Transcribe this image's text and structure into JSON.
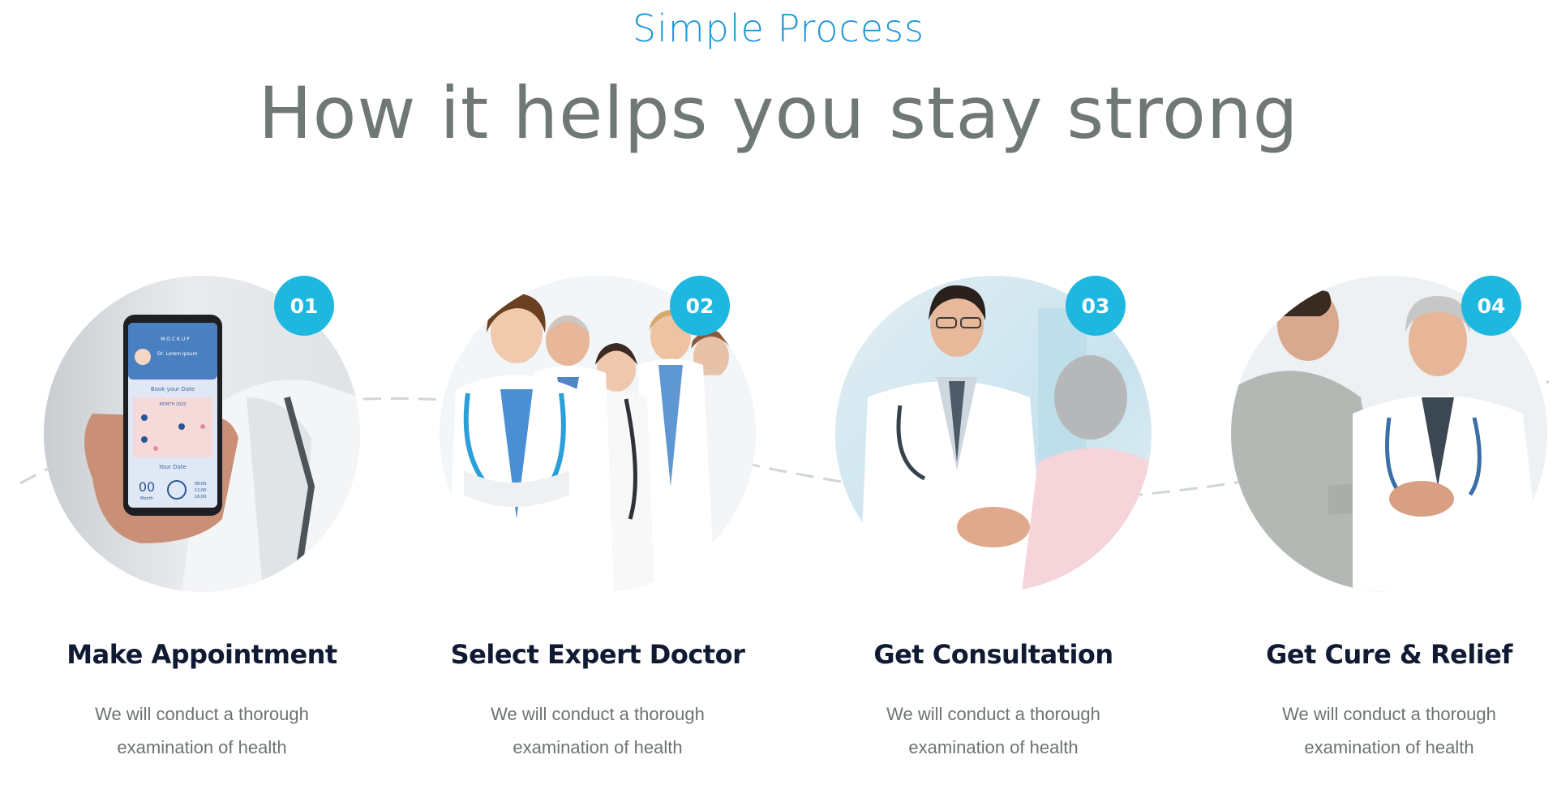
{
  "section": {
    "eyebrow": "Simple Process",
    "headline": "How it helps you stay strong"
  },
  "colors": {
    "eyebrow": "#1f97d9",
    "headline": "#6f7777",
    "badge": "#1eb7df",
    "title": "#101a33",
    "text": "#6d7273"
  },
  "steps": [
    {
      "number": "01",
      "title": "Make Appointment",
      "desc_line1": "We will conduct a thorough",
      "desc_line2": "examination of health",
      "image": "doctor-holding-phone-app",
      "phone": {
        "brand": "M O C K U P",
        "doctor": "Dr. Lorem Ipsum",
        "book_label": "Book your Date",
        "month_label": "MONTH 2020",
        "date_label": "Your Date",
        "count": "00",
        "count_unit": "Month",
        "times": [
          "08:00",
          "12:00",
          "16:00"
        ]
      }
    },
    {
      "number": "02",
      "title": "Select Expert Doctor",
      "desc_line1": "We will conduct a thorough",
      "desc_line2": "examination of health",
      "image": "team-of-doctors"
    },
    {
      "number": "03",
      "title": "Get Consultation",
      "desc_line1": "We will conduct a thorough",
      "desc_line2": "examination of health",
      "image": "doctor-consulting-patient"
    },
    {
      "number": "04",
      "title": "Get Cure & Relief",
      "desc_line1": "We will conduct a thorough",
      "desc_line2": "examination of health",
      "image": "doctor-handshake"
    }
  ]
}
